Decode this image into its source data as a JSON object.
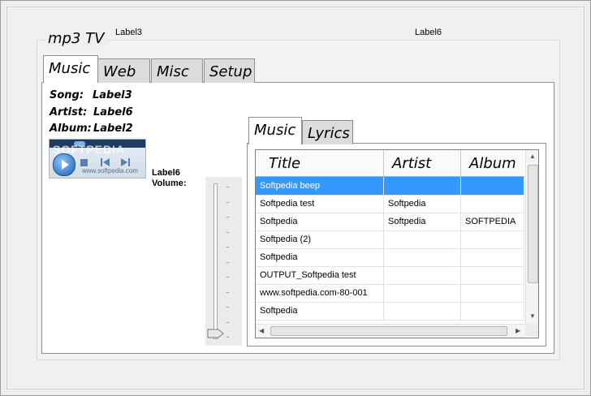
{
  "window": {
    "group_title": "mp3 TV",
    "top_label_left": "Label3",
    "top_label_right": "Label6"
  },
  "tabs": [
    {
      "label": "Music",
      "active": true
    },
    {
      "label": "Web",
      "active": false
    },
    {
      "label": "Misc",
      "active": false
    },
    {
      "label": "Setup",
      "active": false
    }
  ],
  "info": {
    "song_label": "Song:",
    "song_value": "Label3",
    "artist_label": "Artist:",
    "artist_value": "Label6",
    "album_label": "Album:",
    "album_value": "Label2"
  },
  "player": {
    "watermark": "SOFTPEDIA",
    "url": "www.softpedia.com"
  },
  "volume": {
    "top_label": "Label6",
    "label": "Volume:",
    "level": 0
  },
  "inner_tabs": [
    {
      "label": "Music",
      "active": true
    },
    {
      "label": "Lyrics",
      "active": false
    }
  ],
  "playlist": {
    "columns": [
      "Title",
      "Artist",
      "Album"
    ],
    "rows": [
      {
        "title": "Softpedia beep",
        "artist": "",
        "album": "",
        "selected": true
      },
      {
        "title": "Softpedia test",
        "artist": "Softpedia",
        "album": ""
      },
      {
        "title": "Softpedia",
        "artist": "Softpedia",
        "album": "SOFTPEDIA"
      },
      {
        "title": "Softpedia (2)",
        "artist": "",
        "album": ""
      },
      {
        "title": "Softpedia",
        "artist": "",
        "album": ""
      },
      {
        "title": "OUTPUT_Softpedia test",
        "artist": "",
        "album": ""
      },
      {
        "title": "www.softpedia.com-80-001",
        "artist": "",
        "album": ""
      },
      {
        "title": "Softpedia",
        "artist": "",
        "album": ""
      }
    ]
  },
  "colors": {
    "selection": "#3399ff"
  }
}
